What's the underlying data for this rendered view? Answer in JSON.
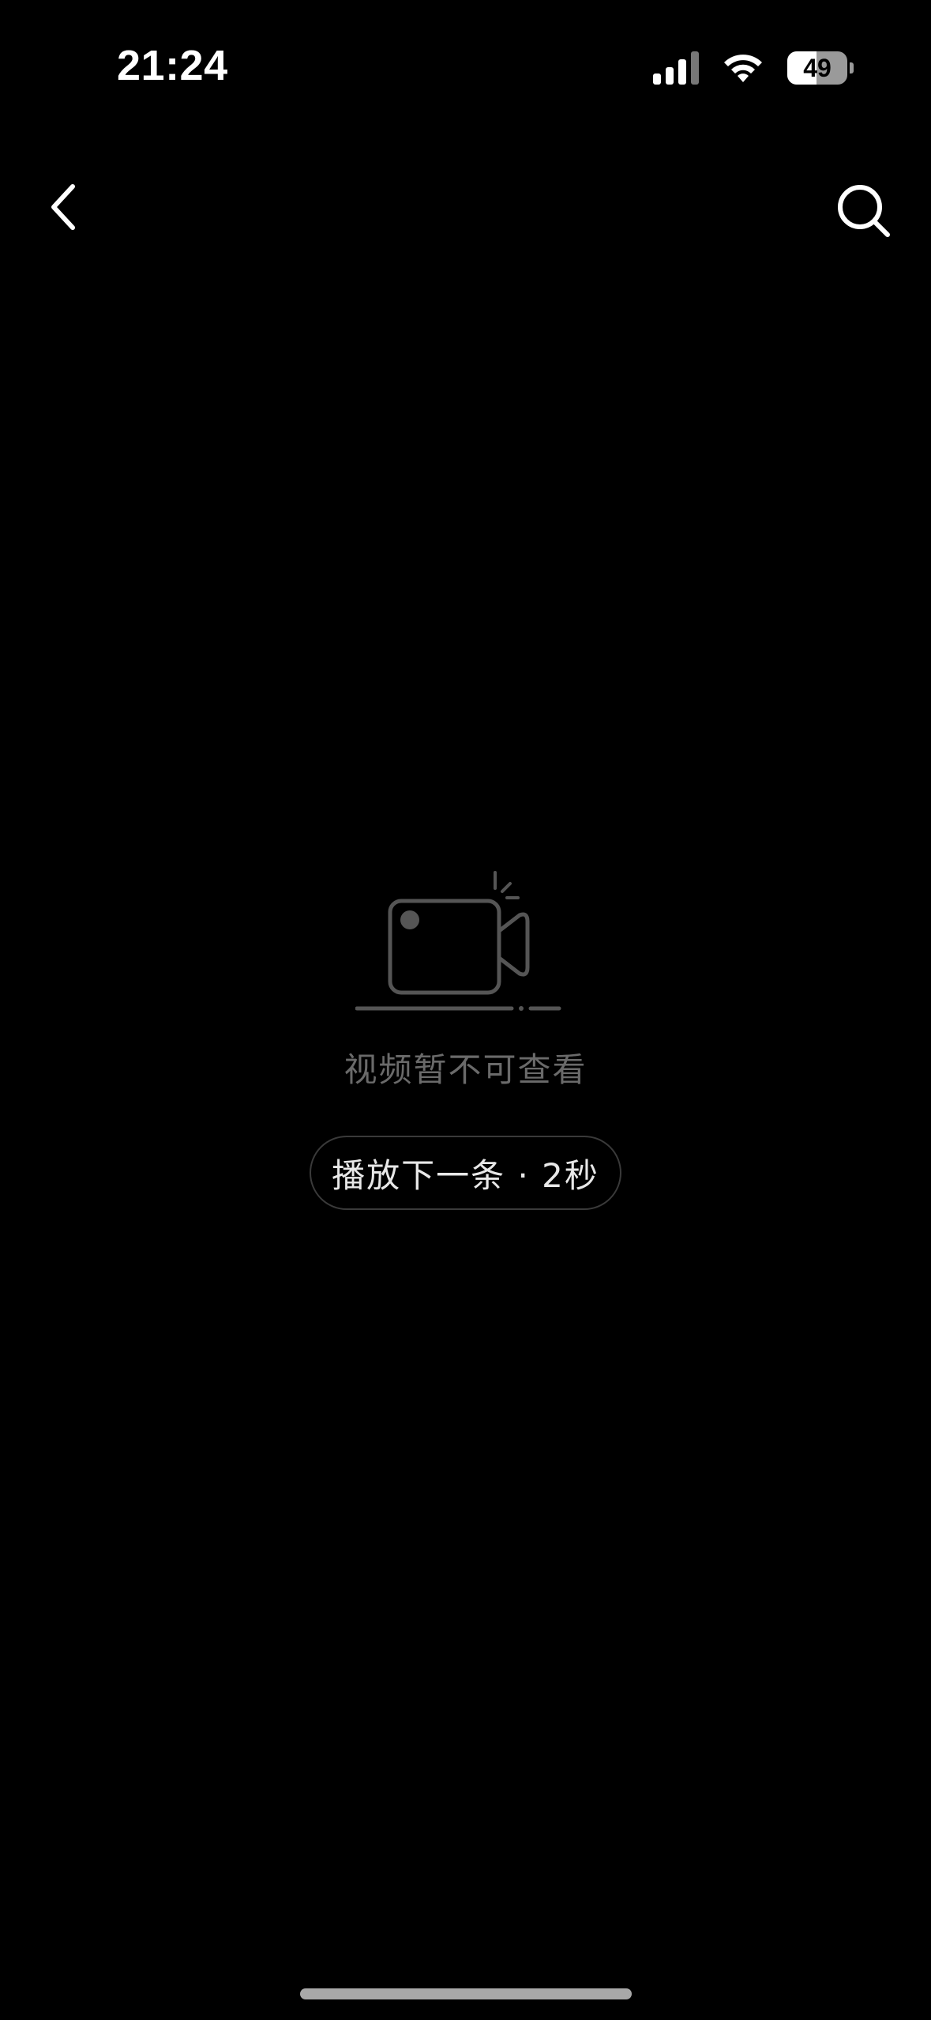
{
  "status_bar": {
    "time": "21:24",
    "battery_level": "49",
    "battery_fraction": 0.49,
    "signal_bars_active": 3,
    "signal_bars_total": 4
  },
  "nav": {
    "back_icon": "chevron-left-icon",
    "search_icon": "search-icon"
  },
  "empty_state": {
    "icon": "video-camera-icon",
    "message": "视频暂不可查看",
    "next_button_label": "播放下一条 · 2秒"
  },
  "colors": {
    "background": "#000000",
    "message_text": "#6a6a6a",
    "button_text": "#e8e8e8",
    "button_border": "#3a3a3a"
  }
}
